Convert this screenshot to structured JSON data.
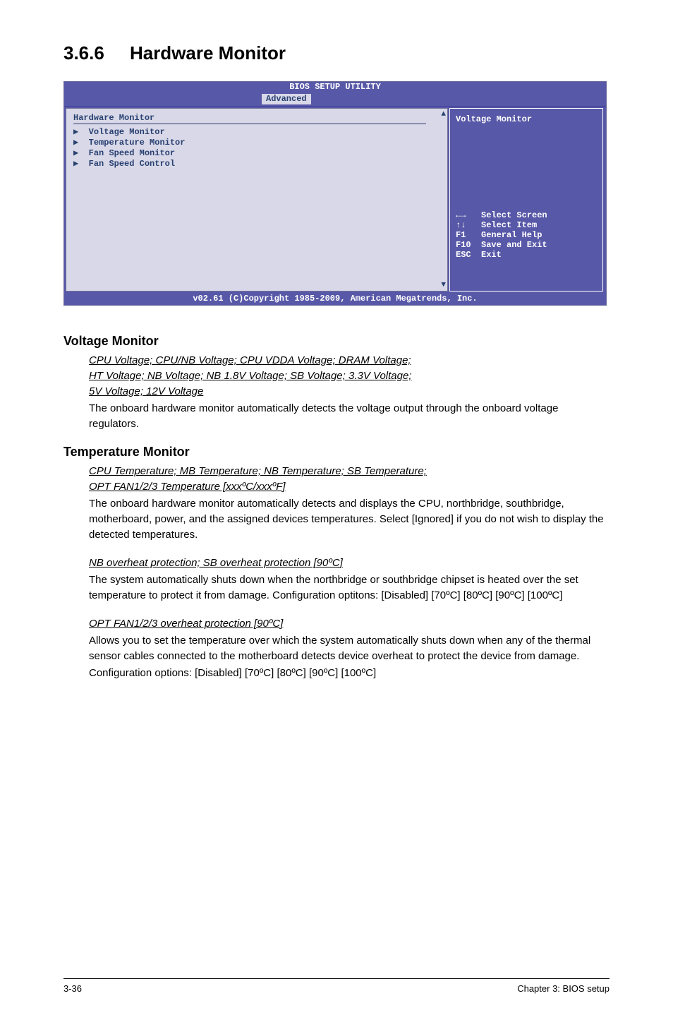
{
  "section_number": "3.6.6",
  "section_title": "Hardware Monitor",
  "bios": {
    "title": "BIOS SETUP UTILITY",
    "active_tab": "Advanced",
    "panel_header": "Hardware Monitor",
    "menu_items": [
      "Voltage Monitor",
      "Temperature Monitor",
      "Fan Speed Monitor",
      "Fan Speed Control"
    ],
    "help_text": "Voltage Monitor",
    "nav": [
      {
        "key": "←→",
        "label": "Select Screen"
      },
      {
        "key": "↑↓",
        "label": "Select Item"
      },
      {
        "key": "F1",
        "label": "General Help"
      },
      {
        "key": "F10",
        "label": "Save and Exit"
      },
      {
        "key": "ESC",
        "label": "Exit"
      }
    ],
    "footer": "v02.61 (C)Copyright 1985-2009, American Megatrends, Inc."
  },
  "sections": {
    "voltage_monitor": {
      "heading": "Voltage Monitor",
      "link_lines": [
        "CPU Voltage; CPU/NB Voltage; CPU VDDA Voltage; DRAM Voltage;",
        "HT Voltage; NB Voltage; NB 1.8V Voltage; SB Voltage; 3.3V Voltage;",
        "5V Voltage; 12V Voltage"
      ],
      "body": "The onboard hardware monitor automatically detects the voltage output through the onboard voltage regulators."
    },
    "temperature_monitor": {
      "heading": "Temperature Monitor",
      "sub1": {
        "link_lines": [
          "CPU Temperature; MB Temperature; NB Temperature; SB Temperature;",
          "OPT FAN1/2/3 Temperature [xxxºC/xxxºF]"
        ],
        "body": "The onboard hardware monitor automatically detects and displays the CPU, northbridge, southbridge, motherboard, power, and the assigned devices temperatures. Select [Ignored] if you do not wish to display the detected temperatures."
      },
      "sub2": {
        "link_lines": [
          "NB overheat protection; SB overheat protection [90ºC]"
        ],
        "body": "The system automatically shuts down when the northbridge or southbridge chipset is heated over the set temperature to protect it from damage. Configuration optitons: [Disabled] [70ºC] [80ºC] [90ºC] [100ºC]"
      },
      "sub3": {
        "link_lines": [
          "OPT FAN1/2/3 overheat protection [90ºC]"
        ],
        "body": "Allows you to set the temperature over which the system automatically shuts down when any of the thermal sensor cables connected to the motherboard detects device overheat to protect the device from damage.",
        "body2": "Configuration options: [Disabled] [70ºC] [80ºC] [90ºC] [100ºC]"
      }
    }
  },
  "footer": {
    "left": "3-36",
    "right": "Chapter 3: BIOS setup"
  }
}
